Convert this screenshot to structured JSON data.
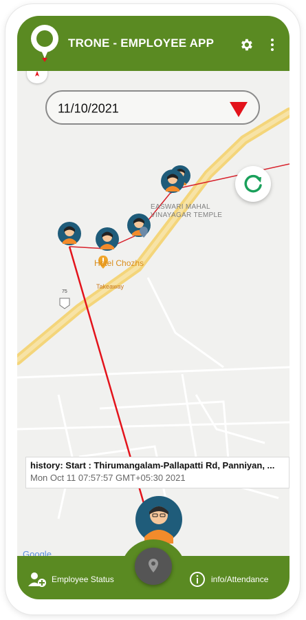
{
  "app": {
    "title": "TRONE - EMPLOYEE APP",
    "colors": {
      "primary": "#5a8a22",
      "route": "#e3131b",
      "accent": "#1aa05b"
    }
  },
  "header_icons": [
    "logo-pin-icon",
    "gear-icon",
    "more-vert-icon"
  ],
  "date_filter": {
    "value": "11/10/2021",
    "dropdown_icon": "caret-down-icon"
  },
  "map": {
    "poi": {
      "temple_line1": "EASWARI MAHAL",
      "temple_line2": "VINAYAGAR TEMPLE",
      "hotel": "Hotel Chozhs",
      "takeaway": "Takeaway",
      "road_shield": "75"
    },
    "google_label": "Google"
  },
  "history_card": {
    "title": "history: Start : Thirumangalam-Pallapatti Rd, Panniyan, ...",
    "timestamp": "Mon Oct 11 07:57:57 GMT+05:30 2021"
  },
  "bottom_nav": {
    "left_label": "Employee Status",
    "right_label": "info/Attendance",
    "center_icon": "location-pin-icon"
  }
}
